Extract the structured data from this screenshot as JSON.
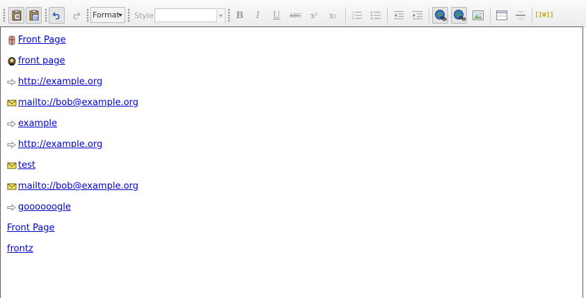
{
  "toolbar": {
    "format_label": "Format",
    "style_label": "Style",
    "style_value": "",
    "buttons": [
      "paste-icon",
      "paste-from-word-icon",
      "undo-icon",
      "redo-icon",
      "bold-icon",
      "italic-icon",
      "underline-icon",
      "strikethrough-icon",
      "superscript-icon",
      "subscript-icon",
      "numbered-list-icon",
      "bulleted-list-icon",
      "outdent-icon",
      "indent-icon",
      "insert-link-icon",
      "remove-link-icon",
      "insert-image-icon",
      "insert-table-icon",
      "horizontal-rule-icon",
      "wiki-link-icon"
    ],
    "glyphs": {
      "bold": "B",
      "italic": "I",
      "underline": "U",
      "strike": "ABC",
      "superscript": "x²",
      "subscript": "x₂",
      "wiki": "[[W]]"
    }
  },
  "editor": {
    "links": [
      {
        "text": "Front Page",
        "icon": "wiki-page-icon"
      },
      {
        "text": "front page",
        "icon": "wiki-page-icon"
      },
      {
        "text": "http://example.org",
        "icon": "external-link-icon"
      },
      {
        "text": "mailto://bob@example.org",
        "icon": "email-icon"
      },
      {
        "text": "example",
        "icon": "external-link-icon"
      },
      {
        "text": "http://example.org",
        "icon": "external-link-icon"
      },
      {
        "text": "test",
        "icon": "email-icon"
      },
      {
        "text": "mailto://bob@example.org",
        "icon": "email-icon"
      },
      {
        "text": "goooooogle",
        "icon": "external-link-icon"
      },
      {
        "text": "Front Page",
        "icon": ""
      },
      {
        "text": "frontz",
        "icon": ""
      }
    ]
  },
  "colors": {
    "link": "#0000cc",
    "editor_border": "#5e5e5e",
    "toolbar_bg": "#ececec"
  }
}
